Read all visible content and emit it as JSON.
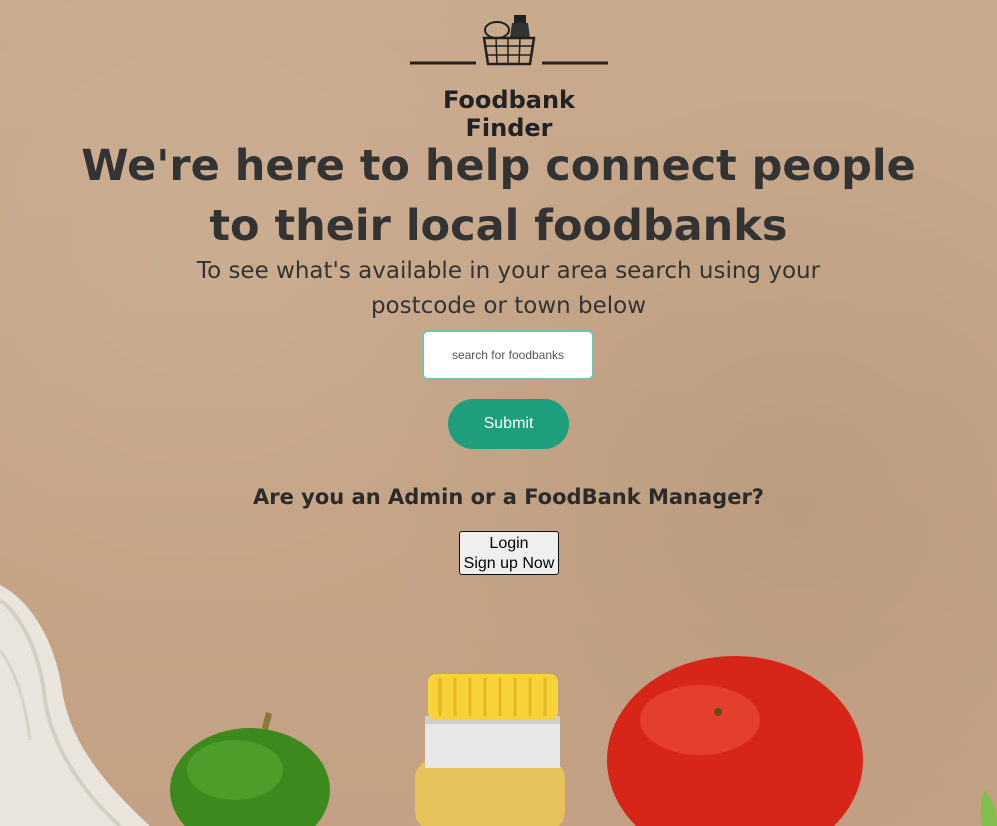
{
  "brand": {
    "name": "Foodbank Finder",
    "logo_icon": "shopping-basket-icon"
  },
  "hero": {
    "headline": "We're here to help connect people to their local foodbanks",
    "subtext": "To see what's available in your area search using your postcode or town below"
  },
  "search": {
    "placeholder": "search for foodbanks",
    "value": ""
  },
  "submit": {
    "label": "Submit"
  },
  "admin": {
    "question": "Are you an Admin or a FoodBank Manager?",
    "login_label": "Login",
    "signup_label": "Sign up Now"
  },
  "colors": {
    "background": "#c8a88a",
    "accent": "#1e9e7d",
    "input_border": "#72c2ad",
    "text": "#333333"
  }
}
